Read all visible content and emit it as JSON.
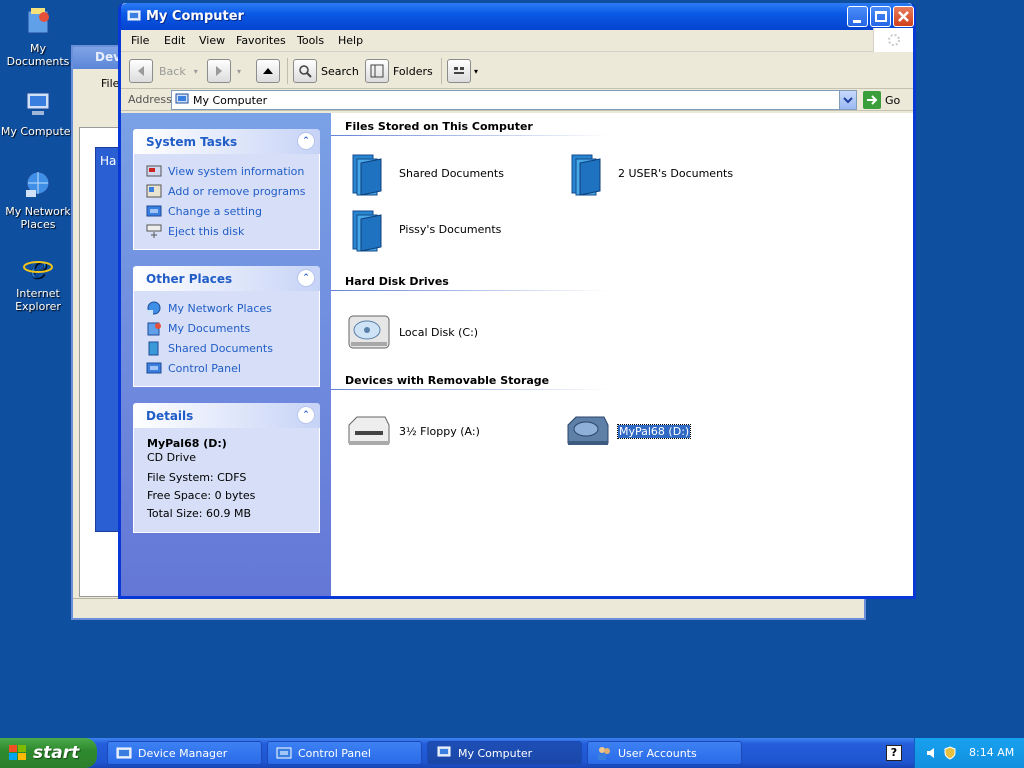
{
  "desktop": {
    "icons": [
      {
        "label": "My Documents"
      },
      {
        "label": "My Computer"
      },
      {
        "label": "My Network Places"
      },
      {
        "label": "Internet Explorer"
      }
    ]
  },
  "background_window": {
    "title": "Dev",
    "menu_first": "File",
    "pane_label": "Ha"
  },
  "window": {
    "title": "My Computer",
    "menu": [
      "File",
      "Edit",
      "View",
      "Favorites",
      "Tools",
      "Help"
    ],
    "toolbar": {
      "back": "Back",
      "search": "Search",
      "folders": "Folders"
    },
    "address": {
      "label": "Address",
      "value": "My Computer",
      "go": "Go"
    }
  },
  "left_pane": {
    "system_tasks": {
      "title": "System Tasks",
      "items": [
        "View system information",
        "Add or remove programs",
        "Change a setting",
        "Eject this disk"
      ]
    },
    "other_places": {
      "title": "Other Places",
      "items": [
        "My Network Places",
        "My Documents",
        "Shared Documents",
        "Control Panel"
      ]
    },
    "details": {
      "title": "Details",
      "name": "MyPal68 (D:)",
      "type": "CD Drive",
      "file_system": "File System: CDFS",
      "free_space": "Free Space: 0 bytes",
      "total_size": "Total Size: 60.9 MB"
    }
  },
  "content": {
    "groups": [
      {
        "header": "Files Stored on This Computer",
        "items": [
          "Shared Documents",
          "2 USER's Documents",
          "Pissy's Documents"
        ]
      },
      {
        "header": "Hard Disk Drives",
        "items": [
          "Local Disk (C:)"
        ]
      },
      {
        "header": "Devices with Removable Storage",
        "items": [
          "3½ Floppy (A:)",
          "MyPal68 (D:)"
        ]
      }
    ]
  },
  "taskbar": {
    "start": "start",
    "apps": [
      "Device Manager",
      "Control Panel",
      "My Computer",
      "User Accounts"
    ],
    "clock": "8:14 AM"
  }
}
